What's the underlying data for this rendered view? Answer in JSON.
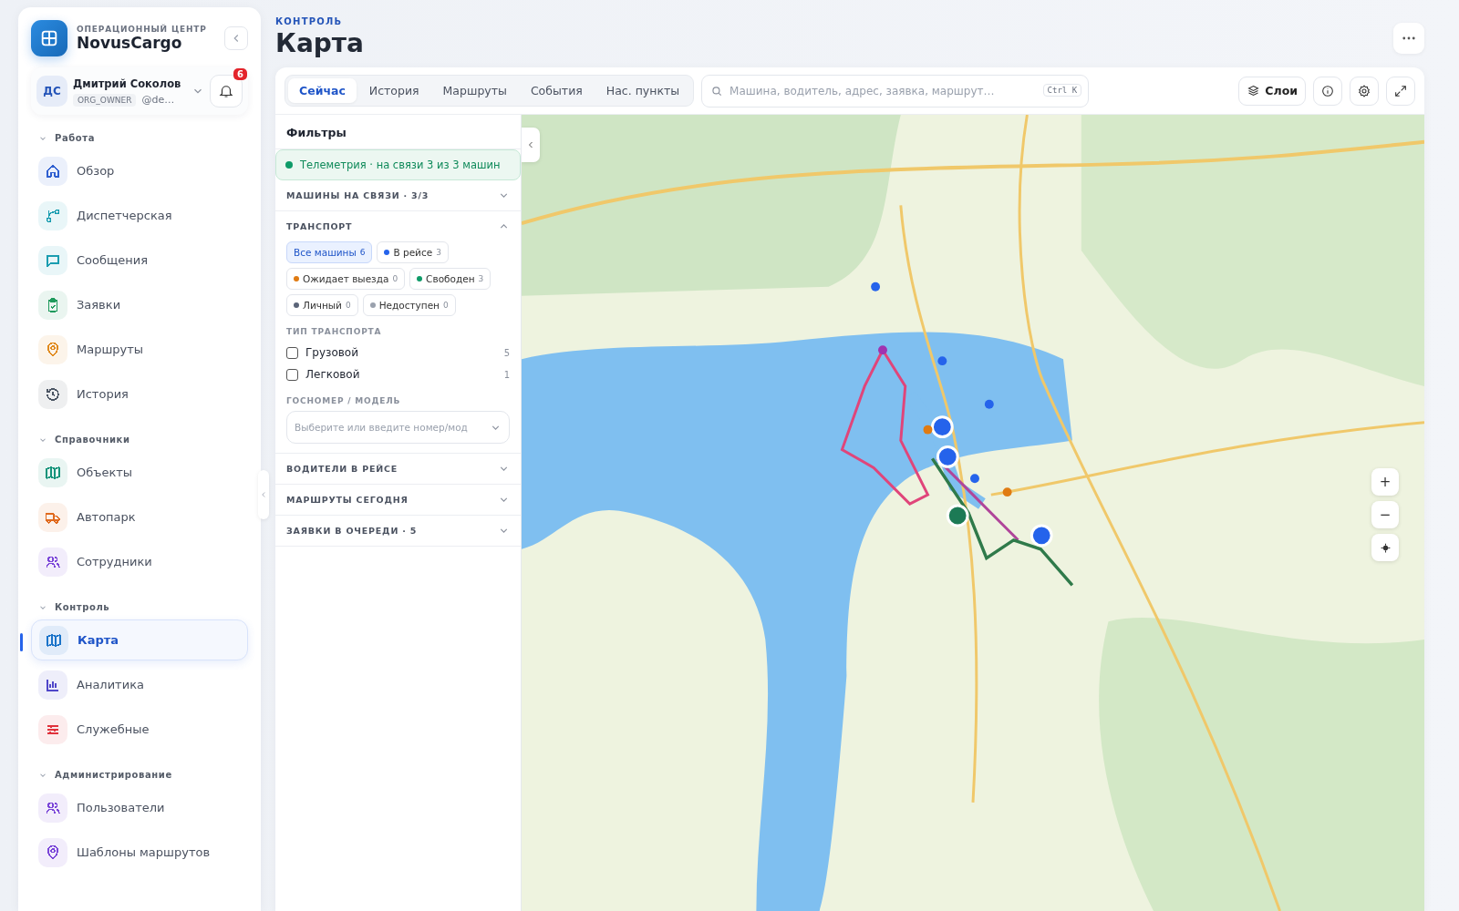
{
  "sidebar": {
    "org_caption": "ОПЕРАЦИОННЫЙ ЦЕНТР",
    "org_name": "NovusCargo",
    "user": {
      "initials": "ДС",
      "name": "Дмитрий Соколов",
      "role": "ORG_OWNER",
      "handle": "@de…",
      "notifications": "6"
    },
    "sections": [
      {
        "title": "Работа",
        "expanded": true,
        "items": [
          {
            "label": "Обзор",
            "color": "#2f5fd0",
            "selected": false
          },
          {
            "label": "Диспетчерская",
            "color": "#1a9db0",
            "selected": false
          },
          {
            "label": "Сообщения",
            "color": "#1a9db0",
            "selected": false
          },
          {
            "label": "Заявки",
            "color": "#1f9a5c",
            "selected": false
          },
          {
            "label": "Маршруты",
            "color": "#e08a1e",
            "selected": false
          },
          {
            "label": "История",
            "color": "#4b5563",
            "selected": false
          }
        ]
      },
      {
        "title": "Справочники",
        "expanded": true,
        "items": [
          {
            "label": "Объекты",
            "color": "#14937a",
            "selected": false
          },
          {
            "label": "Автопарк",
            "color": "#e06a1e",
            "selected": false
          },
          {
            "label": "Сотрудники",
            "color": "#7a45d8",
            "selected": false
          }
        ]
      },
      {
        "title": "Контроль",
        "expanded": true,
        "items": [
          {
            "label": "Карта",
            "color": "#1a73c9",
            "selected": true
          },
          {
            "label": "Аналитика",
            "color": "#4f46c9",
            "selected": false
          },
          {
            "label": "Служебные",
            "color": "#e0323c",
            "selected": false
          }
        ]
      },
      {
        "title": "Администрирование",
        "expanded": true,
        "items": [
          {
            "label": "Пользователи",
            "color": "#7a45d8",
            "selected": false
          },
          {
            "label": "Шаблоны маршрутов",
            "color": "#7a45d8",
            "selected": false
          }
        ]
      }
    ]
  },
  "header": {
    "breadcrumb": "КОНТРОЛЬ",
    "title": "Карта"
  },
  "tabs": [
    {
      "label": "Сейчас",
      "selected": true
    },
    {
      "label": "История",
      "selected": false
    },
    {
      "label": "Маршруты",
      "selected": false
    },
    {
      "label": "События",
      "selected": false
    },
    {
      "label": "Нас. пункты",
      "selected": false
    }
  ],
  "search": {
    "placeholder": "Машина, водитель, адрес, заявка, маршрут…",
    "shortcut": "Ctrl K"
  },
  "toolbar": {
    "layers_label": "Слои"
  },
  "filters": {
    "title": "Фильтры",
    "telemetry": "Телеметрия · на связи 3 из 3 машин",
    "groups": [
      {
        "title": "МАШИНЫ НА СВЯЗИ · 3/3",
        "expanded": false
      },
      {
        "title": "ТРАНСПОРТ",
        "expanded": true,
        "chips": [
          {
            "label": "Все машины",
            "count": "6",
            "selected": true
          },
          {
            "label": "В рейсе",
            "count": "3",
            "color": "#2563eb",
            "selected": false
          },
          {
            "label": "Ожидает выезда",
            "count": "0",
            "color": "#e07b12",
            "selected": false
          },
          {
            "label": "Свободен",
            "count": "3",
            "color": "#0f9b68",
            "selected": false
          },
          {
            "label": "Личный",
            "count": "0",
            "color": "#5b6478",
            "selected": false
          },
          {
            "label": "Недоступен",
            "count": "0",
            "color": "#9aa1ad",
            "selected": false
          }
        ],
        "type_label": "ТИП ТРАНСПОРТА",
        "types": [
          {
            "label": "Грузовой",
            "count": "5",
            "checked": false
          },
          {
            "label": "Легковой",
            "count": "1",
            "checked": false
          }
        ],
        "plate_label": "ГОСНОМЕР / МОДЕЛЬ",
        "plate_placeholder": "Выберите или введите номер/мод"
      },
      {
        "title": "ВОДИТЕЛИ В РЕЙСЕ",
        "expanded": false
      },
      {
        "title": "МАРШРУТЫ СЕГОДНЯ",
        "expanded": false
      },
      {
        "title": "ЗАЯВКИ В ОЧЕРЕДИ · 5",
        "expanded": false
      }
    ]
  },
  "map": {
    "zoom_in": "+",
    "zoom_out": "−"
  }
}
